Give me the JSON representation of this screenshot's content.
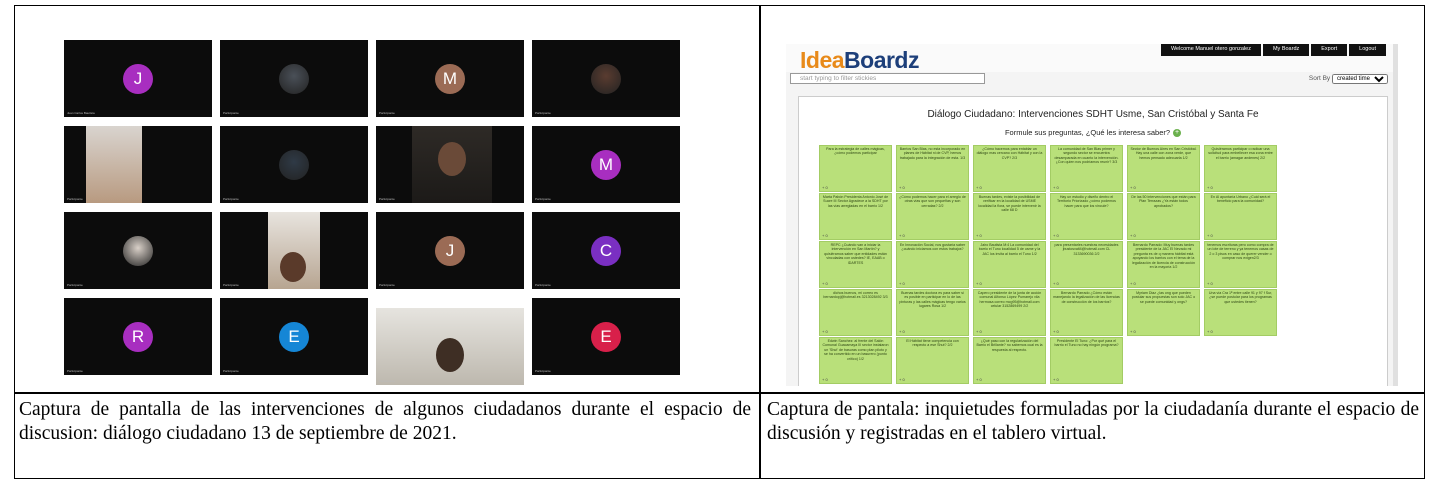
{
  "left_panel": {
    "tiles": [
      {
        "letter": "J",
        "color": "#a82ec0",
        "name": "Juan Carlos Bautista"
      },
      {
        "letter": "",
        "color": "",
        "name": "Participante"
      },
      {
        "letter": "M",
        "color": "#9b6b55",
        "name": "Participante"
      },
      {
        "letter": "",
        "color": "",
        "name": "Participante"
      },
      {
        "letter": "",
        "color": "",
        "name": "Participante"
      },
      {
        "letter": "",
        "color": "",
        "name": "Participante"
      },
      {
        "letter": "",
        "color": "",
        "name": "Participante"
      },
      {
        "letter": "M",
        "color": "#a82ec0",
        "name": "Participante"
      },
      {
        "letter": "",
        "color": "",
        "name": "Participante"
      },
      {
        "letter": "",
        "color": "",
        "name": "Participante"
      },
      {
        "letter": "J",
        "color": "#9b6b55",
        "name": "Participante"
      },
      {
        "letter": "C",
        "color": "#7a2fc2",
        "name": "Participante"
      },
      {
        "letter": "R",
        "color": "#a82ec0",
        "name": "Participante"
      },
      {
        "letter": "E",
        "color": "#1586d6",
        "name": "Participante"
      },
      {
        "letter": "",
        "color": "",
        "name": "Participante"
      },
      {
        "letter": "E",
        "color": "#d8204a",
        "name": "Participante"
      }
    ]
  },
  "right_panel": {
    "logo_part1": "Idea",
    "logo_part2": "Boardz",
    "menu": [
      "Welcome Manuel otero gonzalez",
      "My Boardz",
      "Export",
      "Logout"
    ],
    "search_placeholder": "start typing to filter stickies",
    "sort_label": "Sort By",
    "sort_value": "created time",
    "board_title": "Diálogo Ciudadano: Intervenciones SDHT Usme, San Cristóbal y Santa Fe",
    "board_prompt": "Formule sus preguntas, ¿Qué les interesa saber?",
    "stickies": [
      {
        "text": "Para la estrategia de calles mágicas, ¿cómo podemos participar",
        "votes": "+ 0"
      },
      {
        "text": "Barrios San Blas, no esta incorporado en planes de Hábitat ni de CVP, hemos trabajado para la integración de esta. 1/3",
        "votes": "+ 0"
      },
      {
        "text": "¿Cómo hacemos para entablar un diálogo mas cercano con Hábitat y con la CVP? 2/3",
        "votes": "+ 0"
      },
      {
        "text": "La comunidad de San Blas primer y segundo sector se encuentra desamparada en cuanto la intervención. ¿Con quien nos podríamos reunir? 3/3",
        "votes": "+ 0"
      },
      {
        "text": "Sector de Buenos Aires en San Cristóbal. Hay una calle con zona verde, que hemos pensado adecuarla 1/2",
        "votes": "+ 0"
      },
      {
        "text": "Quisiéramos participar o radicar una solicitud para embellecer esa zona entre el barrio (amagar andenes) 2/2",
        "votes": "+ 0"
      },
      {
        "text": "Marta Pabón Presidenta Antonio José de Sucre III Sector Agradece a la SDHT por las vías arregladas en el barrio 1/2",
        "votes": "+ 0"
      },
      {
        "text": "¿Cómo podemos hacer para el arreglo de otras vías que son pequeñas y son cerradas? 2/2",
        "votes": "+ 0"
      },
      {
        "text": "Buenas tardes, existe la posibilidad de verificar en la localidad de USME localidad la flora, se puede intervenir la calle 68 D",
        "votes": "+ 0"
      },
      {
        "text": "Hay un estudio y diseño dentro el Territorio Priorizado ¿cómo podemos hacer para que los vincule?",
        "votes": "+ 0"
      },
      {
        "text": "De las 50 intervenciones que están para Plan Terrazas ¿Ya están todos aprobados?",
        "votes": "+ 0"
      },
      {
        "text": "En Al apuntaría Urbano ¿Cuál será el beneficio para la comunidad?",
        "votes": "+ 0"
      },
      {
        "text": "REPC ¿Cuándo van a iniciar la intervención en San Martín? y quisiéramos saber que entidades están vinculadas con ustedes? IE, EAAB o IDARTES",
        "votes": "+ 0"
      },
      {
        "text": "En Innovación Social, nos gustaría saber ¿cuándo iniciamos con estos trabajos?",
        "votes": "+ 0"
      },
      {
        "text": "Jairo Bautista M:4 La comunidad del barrio el Tuno localidad 5 de usme y la JAC los invita al barrio el Tuno 1/2",
        "votes": "+ 0"
      },
      {
        "text": "para presentarles nuestras necesidades jbustosvalt4@hotmail.com CL 3133690036 2/2",
        "votes": "+ 0"
      },
      {
        "text": "Bernardo Parrado: Muy buenas tardes presidente de la JAC El Nevado mi pregunta es de q manera hábitat está apoyando los barrios con el tema de la legalización de licencia de construcción en la mayoría 1/2",
        "votes": "+ 0"
      },
      {
        "text": "tenemos escrituras pero como compra de un lote de terreno y ya tenemos casas de 2 o 3 pisos en caso de querer vender o comprar nos exigen2/3",
        "votes": "+ 0"
      },
      {
        "text": "dichos buenos, mi correo es bernardopj@hotmail.es 3213028492 3/3",
        "votes": "+ 0"
      },
      {
        "text": "Buenas tardes doctora es para saber si es posible en participar en lo de las pinturas y las calles mágicas tengo varios lugares Rosa 1/2",
        "votes": "+ 0"
      },
      {
        "text": "Capero presidente de la junta de acción comunal Alfonso López Pumarejo vila hermosa correo mcg95@hotmail.com celular 3152869499 2/2",
        "votes": "+ 0"
      },
      {
        "text": "Bernardo Parrado ¿Cómo están manejando la legalización de las licencias de construcción de los barrios?",
        "votes": "+ 0"
      },
      {
        "text": "Myriam Diaz ¿las ong que pueden postular sus propuestas son solo JAC o se puede comunidad y ongs?",
        "votes": "+ 0"
      },
      {
        "text": "Una vía Cra 1ª entre calle 91 y 97 f Sur, ¿se puede postular para los programas que ustedes tienen?",
        "votes": "+ 0"
      },
      {
        "text": "Edwin Sanchez: al frente del Salón Comunal Guacamaya III sector instalaron un 'Shut' de basuras como plan piloto y se ha convertido en un basurero (punto crítico) 1/2",
        "votes": "+ 0"
      },
      {
        "text": "El Hábitat tiene competencia con respecto a ese Shut? 2/2",
        "votes": "+ 0"
      },
      {
        "text": "¿Qué paso con la regularización del Barrio el Brillante? no sabemos cual es la respuesta al respecto.",
        "votes": "+ 0"
      },
      {
        "text": "Presidente El Tuno: ¿Por qué para el barrio el Tuno no hay ningún programa?",
        "votes": "+ 0"
      }
    ]
  },
  "captions": {
    "left": "Captura de pantalla de las intervenciones de algunos ciudadanos durante el espacio de discusion: diálogo ciudadano 13 de septiembre de 2021.",
    "right": "Captura de pantala: inquietudes formuladas por la ciudadanía durante el espacio de discusión y registradas en el tablero virtual."
  }
}
